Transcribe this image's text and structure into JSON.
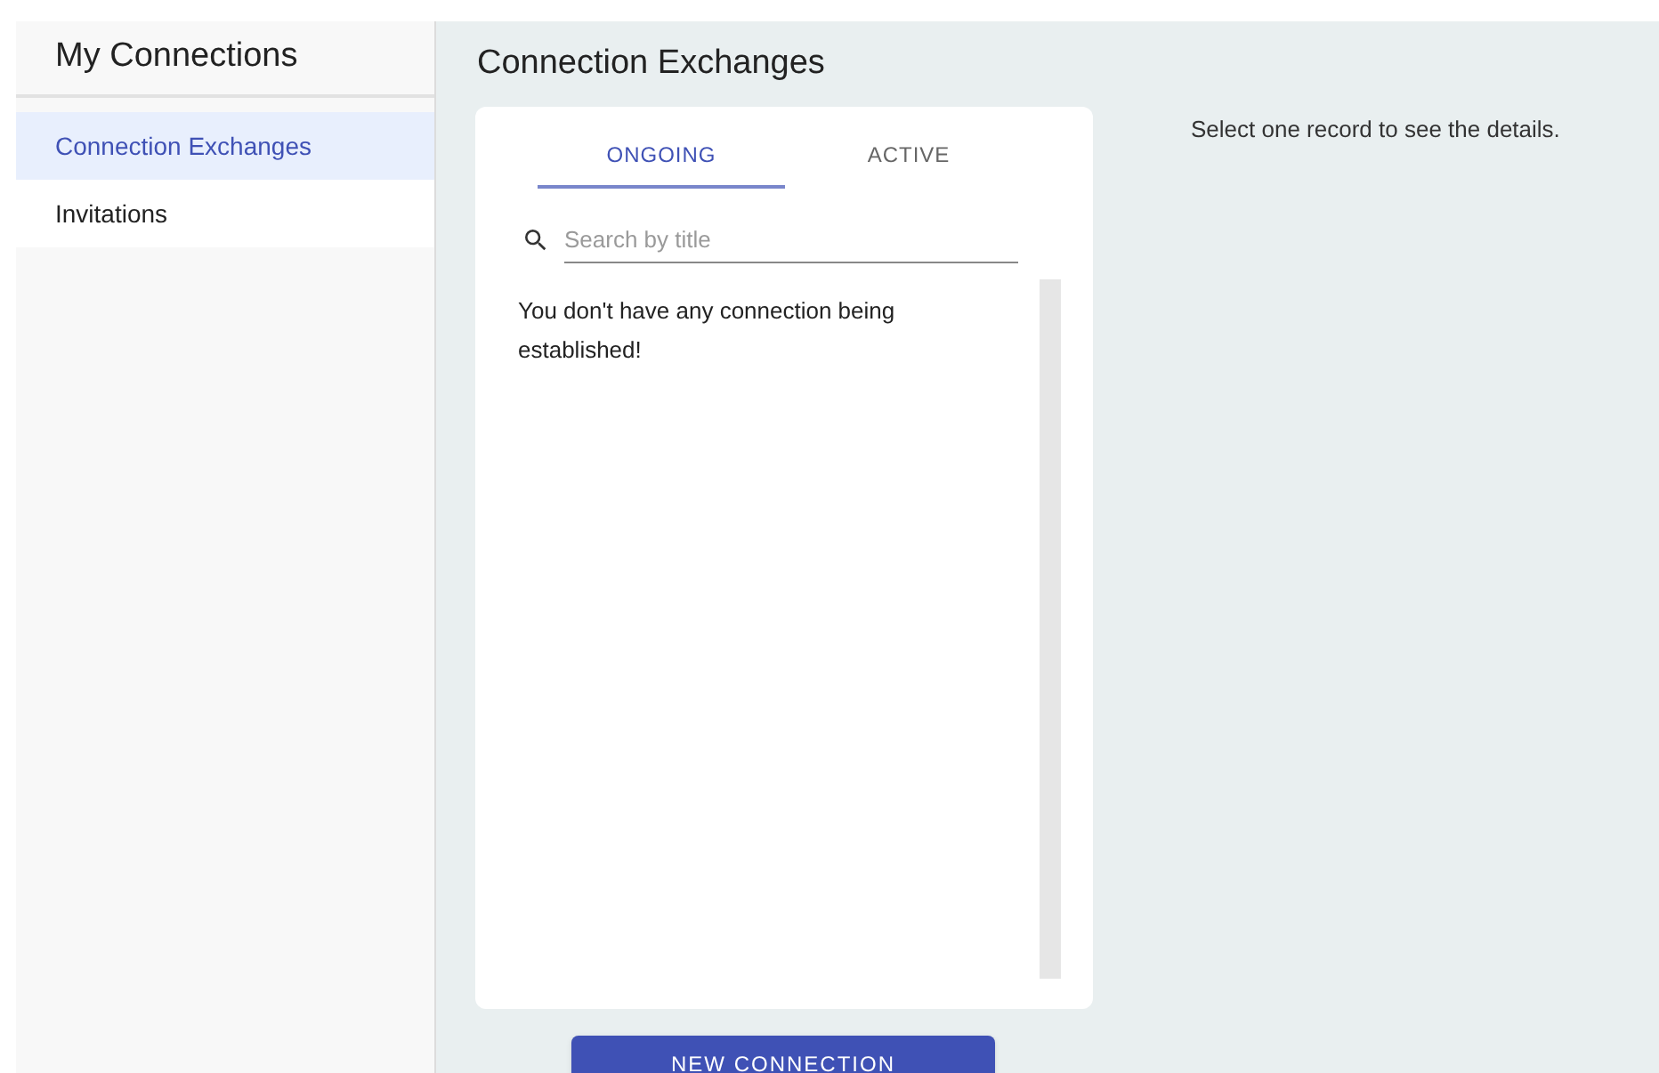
{
  "sidebar": {
    "title": "My Connections",
    "items": [
      {
        "label": "Connection Exchanges",
        "selected": true
      },
      {
        "label": "Invitations",
        "selected": false
      }
    ]
  },
  "main": {
    "title": "Connection Exchanges",
    "tabs": [
      {
        "label": "ONGOING",
        "selected": true
      },
      {
        "label": "ACTIVE",
        "selected": false
      }
    ],
    "search": {
      "placeholder": "Search by title"
    },
    "empty_message": "You don't have any connection being established!",
    "button": "NEW CONNECTION"
  },
  "details": {
    "message": "Select one record to see the details."
  }
}
